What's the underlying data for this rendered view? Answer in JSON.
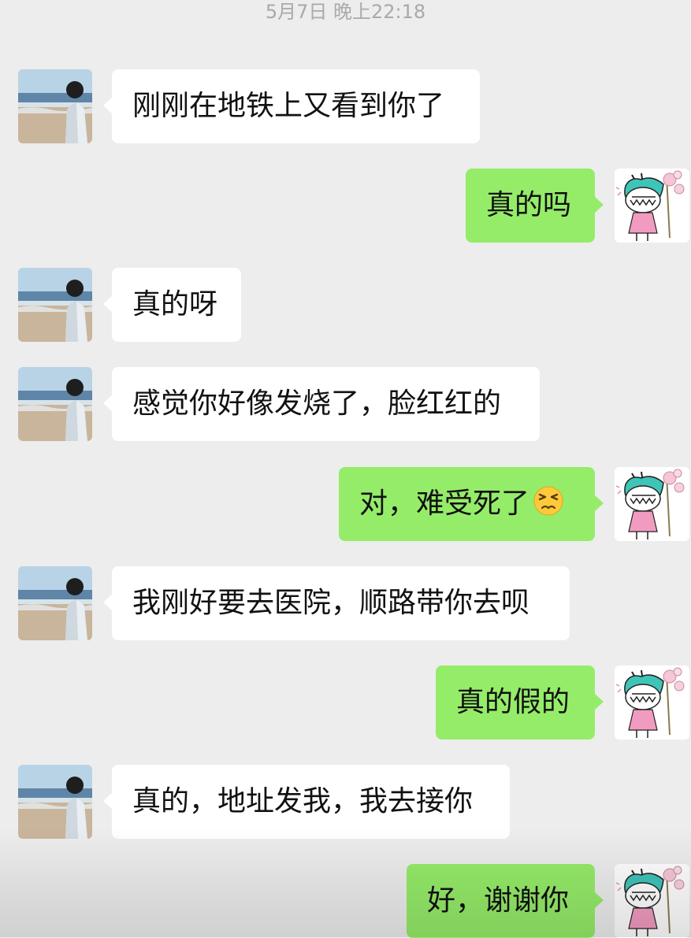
{
  "timestamp": "5月7日 晚上22:18",
  "contact": {
    "avatar_icon": "beach-person-avatar"
  },
  "me": {
    "avatar_icon": "cartoon-girl-avatar"
  },
  "colors": {
    "background": "#ededed",
    "incoming_bubble": "#ffffff",
    "outgoing_bubble": "#95ec69",
    "timestamp_text": "#a9a9a9"
  },
  "messages": [
    {
      "side": "left",
      "text": "刚刚在地铁上又看到你了"
    },
    {
      "side": "right",
      "text": "真的吗"
    },
    {
      "side": "left",
      "text": "真的呀"
    },
    {
      "side": "left",
      "text": "感觉你好像发烧了，脸红红的"
    },
    {
      "side": "right",
      "text": "对，难受死了",
      "emoji": "persevering-face-emoji"
    },
    {
      "side": "left",
      "text": "我刚好要去医院，顺路带你去呗"
    },
    {
      "side": "right",
      "text": "真的假的"
    },
    {
      "side": "left",
      "text": "真的，地址发我，我去接你"
    },
    {
      "side": "right",
      "text": "好，谢谢你"
    }
  ]
}
